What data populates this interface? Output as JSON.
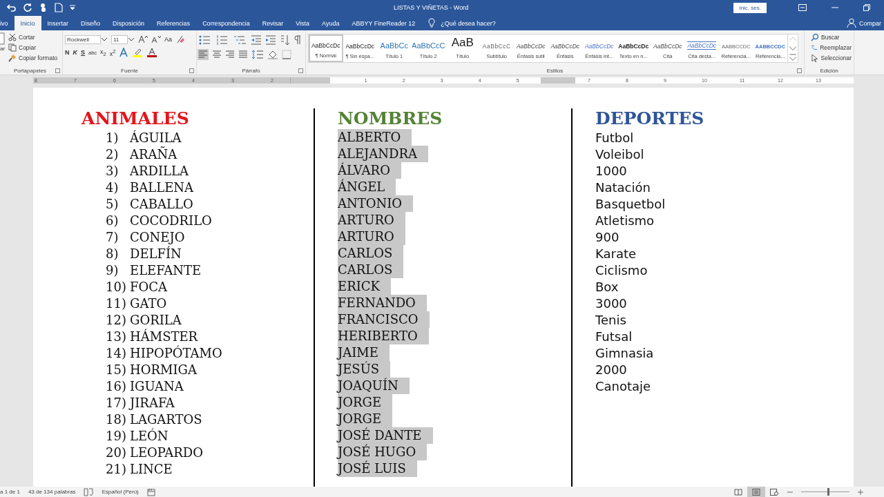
{
  "window": {
    "title": "LISTAS Y VIÑETAS  -  Word",
    "sign_in": "Inic. ses."
  },
  "tabs": [
    {
      "label": "ivo",
      "selected": false
    },
    {
      "label": "Inicio",
      "selected": true
    },
    {
      "label": "Insertar",
      "selected": false
    },
    {
      "label": "Diseño",
      "selected": false
    },
    {
      "label": "Disposición",
      "selected": false
    },
    {
      "label": "Referencias",
      "selected": false
    },
    {
      "label": "Correspondencia",
      "selected": false
    },
    {
      "label": "Revisar",
      "selected": false
    },
    {
      "label": "Vista",
      "selected": false
    },
    {
      "label": "Ayuda",
      "selected": false
    },
    {
      "label": "ABBYY FineReader 12",
      "selected": false
    }
  ],
  "tell_me": "¿Qué desea hacer?",
  "share": "Compar",
  "clipboard": {
    "paste": "ar",
    "cut": "Cortar",
    "copy": "Copiar",
    "format_painter": "Copiar formato",
    "label": "Portapapeles"
  },
  "font": {
    "name": "Rockwell",
    "size": "11",
    "case": "Aa",
    "bold": "N",
    "italic": "K",
    "underline": "S",
    "strike": "abc",
    "subscript": "x$_{2}$",
    "superscript": "x$^{2}$",
    "label": "Fuente"
  },
  "paragraph": {
    "label": "Párrafo"
  },
  "styles": {
    "label": "Estilos",
    "items": [
      {
        "preview": "AaBbCcDc",
        "name": "¶ Normal",
        "selected": true,
        "kind": "normal"
      },
      {
        "preview": "AaBbCcDc",
        "name": "¶ Sin espa...",
        "selected": false,
        "kind": "normal"
      },
      {
        "preview": "AaBbCc",
        "name": "Título 1",
        "selected": false,
        "kind": "heading"
      },
      {
        "preview": "AaBbCcC",
        "name": "Título 2",
        "selected": false,
        "kind": "heading"
      },
      {
        "preview": "AaB",
        "name": "Título",
        "selected": false,
        "kind": "title"
      },
      {
        "preview": "AaBbCcC",
        "name": "Subtítulo",
        "selected": false,
        "kind": "subtle"
      },
      {
        "preview": "AaBbCcDc",
        "name": "Énfasis sutil",
        "selected": false,
        "kind": "italic"
      },
      {
        "preview": "AaBbCcDc",
        "name": "Énfasis",
        "selected": false,
        "kind": "italic"
      },
      {
        "preview": "AaBbCcDc",
        "name": "Énfasis int...",
        "selected": false,
        "kind": "intense"
      },
      {
        "preview": "AaBbCcDc",
        "name": "Texto en n...",
        "selected": false,
        "kind": "strong"
      },
      {
        "preview": "AaBbCcDc",
        "name": "Cita",
        "selected": false,
        "kind": "italic"
      },
      {
        "preview": "AaBbCcDc",
        "name": "Cita desta...",
        "selected": false,
        "kind": "quote"
      },
      {
        "preview": "AABBCCDC",
        "name": "Referencia...",
        "selected": false,
        "kind": "smallcaps"
      },
      {
        "preview": "AABBCCDC",
        "name": "Referencia...",
        "selected": false,
        "kind": "smallcaps-strong"
      }
    ]
  },
  "editing": {
    "label": "Edición",
    "find": "Buscar",
    "replace": "Reemplazar",
    "select": "Seleccionar"
  },
  "ruler": {
    "left_labels": [
      "8",
      "7",
      "6",
      "5",
      "4",
      "3",
      "2"
    ],
    "middle_labels": [
      "1",
      "2",
      "3",
      "4",
      "5"
    ],
    "end_labels": [
      "7",
      "8",
      "9",
      "10",
      "11",
      "12",
      "13"
    ]
  },
  "document": {
    "columns": [
      {
        "heading": "ANIMALES",
        "color": "#e2161b",
        "kind": "numbered",
        "items": [
          {
            "number": "1)",
            "text": "ÁGUILA"
          },
          {
            "number": "2)",
            "text": "ARAÑA"
          },
          {
            "number": "3)",
            "text": "ARDILLA"
          },
          {
            "number": "4)",
            "text": "BALLENA"
          },
          {
            "number": "5)",
            "text": "CABALLO"
          },
          {
            "number": "6)",
            "text": "COCODRILO"
          },
          {
            "number": "7)",
            "text": "CONEJO"
          },
          {
            "number": "8)",
            "text": "DELFÍN"
          },
          {
            "number": "9)",
            "text": "ELEFANTE"
          },
          {
            "number": "10)",
            "text": "FOCA"
          },
          {
            "number": "11)",
            "text": "GATO"
          },
          {
            "number": "12)",
            "text": "GORILA"
          },
          {
            "number": "13)",
            "text": "HÁMSTER"
          },
          {
            "number": "14)",
            "text": "HIPOPÓTAMO"
          },
          {
            "number": "15)",
            "text": "HORMIGA"
          },
          {
            "number": "16)",
            "text": "IGUANA"
          },
          {
            "number": "17)",
            "text": "JIRAFA"
          },
          {
            "number": "18)",
            "text": "LAGARTOS"
          },
          {
            "number": "19)",
            "text": "LEÓN"
          },
          {
            "number": "20)",
            "text": "LEOPARDO"
          },
          {
            "number": "21)",
            "text": "LINCE"
          }
        ]
      },
      {
        "heading": "NOMBRES",
        "color": "#548235",
        "kind": "selected",
        "items": [
          {
            "text": "ALBERTO"
          },
          {
            "text": "ALEJANDRA"
          },
          {
            "text": "ÁLVARO"
          },
          {
            "text": "ÁNGEL"
          },
          {
            "text": "ANTONIO"
          },
          {
            "text": "ARTURO"
          },
          {
            "text": "ARTURO"
          },
          {
            "text": "CARLOS"
          },
          {
            "text": "CARLOS"
          },
          {
            "text": "ERICK"
          },
          {
            "text": "FERNANDO"
          },
          {
            "text": "FRANCISCO"
          },
          {
            "text": "HERIBERTO"
          },
          {
            "text": "JAIME"
          },
          {
            "text": "JESÚS"
          },
          {
            "text": "JOAQUÍN"
          },
          {
            "text": "JORGE"
          },
          {
            "text": "JORGE"
          },
          {
            "text": "JOSÉ DANTE"
          },
          {
            "text": "JOSÉ HUGO"
          },
          {
            "text": "JOSÉ LUIS"
          }
        ]
      },
      {
        "heading": "DEPORTES",
        "color": "#2f5597",
        "kind": "plain",
        "items": [
          {
            "text": "Futbol"
          },
          {
            "text": "Voleibol"
          },
          {
            "text": "1000"
          },
          {
            "text": "Natación"
          },
          {
            "text": "Basquetbol"
          },
          {
            "text": "Atletismo"
          },
          {
            "text": "900"
          },
          {
            "text": "Karate"
          },
          {
            "text": "Ciclismo"
          },
          {
            "text": "Box"
          },
          {
            "text": "3000"
          },
          {
            "text": "Tenis"
          },
          {
            "text": "Futsal"
          },
          {
            "text": "Gimnasia"
          },
          {
            "text": "2000"
          },
          {
            "text": "Canotaje"
          }
        ]
      }
    ]
  },
  "status_bar": {
    "page": "a 1 de 1",
    "words": "43 de 134 palabras",
    "language": "Español (Perú)",
    "views": [
      {
        "kind": "read",
        "selected": false
      },
      {
        "kind": "print",
        "selected": true
      },
      {
        "kind": "web",
        "selected": false
      }
    ],
    "zoom": {
      "level": 0.55
    }
  }
}
